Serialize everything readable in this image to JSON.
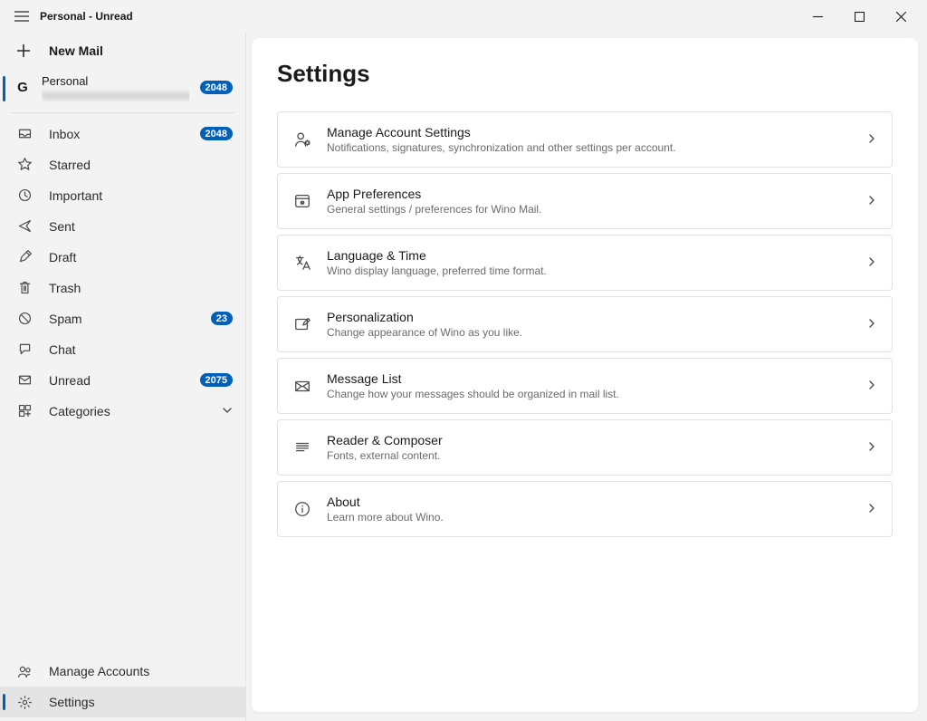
{
  "window": {
    "title": "Personal - Unread"
  },
  "sidebar": {
    "new_mail": "New Mail",
    "account": {
      "avatar_letter": "G",
      "name": "Personal",
      "email_masked": "xxxxxxxxxxxxxxxxxxxxxxxxxxx",
      "badge": "2048"
    },
    "items": [
      {
        "icon": "inbox",
        "label": "Inbox",
        "badge": "2048"
      },
      {
        "icon": "star",
        "label": "Starred",
        "badge": null
      },
      {
        "icon": "clock",
        "label": "Important",
        "badge": null
      },
      {
        "icon": "send",
        "label": "Sent",
        "badge": null
      },
      {
        "icon": "draft",
        "label": "Draft",
        "badge": null
      },
      {
        "icon": "trash",
        "label": "Trash",
        "badge": null
      },
      {
        "icon": "block",
        "label": "Spam",
        "badge": "23"
      },
      {
        "icon": "chat",
        "label": "Chat",
        "badge": null
      },
      {
        "icon": "mail",
        "label": "Unread",
        "badge": "2075"
      },
      {
        "icon": "categories",
        "label": "Categories",
        "badge": null,
        "expandable": true
      }
    ],
    "footer": [
      {
        "icon": "people",
        "label": "Manage Accounts",
        "active": false
      },
      {
        "icon": "gear",
        "label": "Settings",
        "active": true
      }
    ]
  },
  "main": {
    "heading": "Settings",
    "items": [
      {
        "icon": "account",
        "title": "Manage Account Settings",
        "desc": "Notifications, signatures, synchronization and other settings per account."
      },
      {
        "icon": "appprefs",
        "title": "App Preferences",
        "desc": "General settings / preferences for Wino Mail."
      },
      {
        "icon": "language",
        "title": "Language & Time",
        "desc": "Wino display language, preferred time format."
      },
      {
        "icon": "personal",
        "title": "Personalization",
        "desc": "Change appearance of Wino as you like."
      },
      {
        "icon": "msglist",
        "title": "Message List",
        "desc": "Change how your messages should be organized in mail list."
      },
      {
        "icon": "reader",
        "title": "Reader & Composer",
        "desc": "Fonts, external content."
      },
      {
        "icon": "info",
        "title": "About",
        "desc": "Learn more about Wino."
      }
    ]
  }
}
